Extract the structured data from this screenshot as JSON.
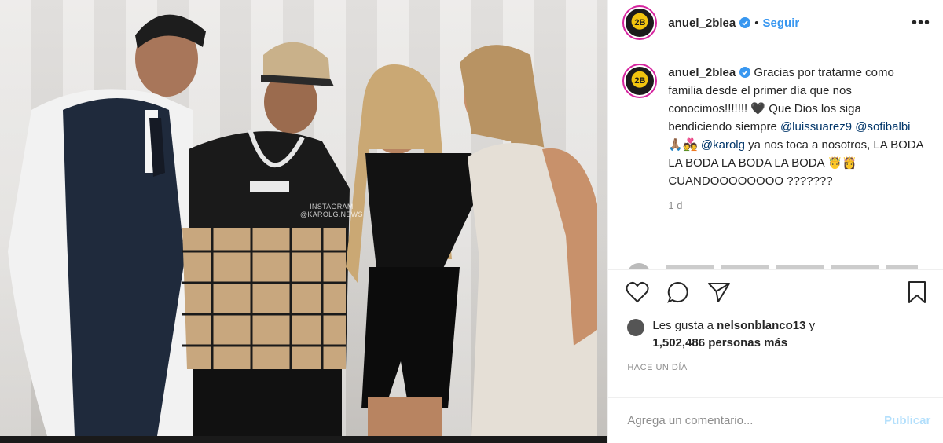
{
  "photo": {
    "watermark_line1": "INSTAGRAM",
    "watermark_line2": "@KAROLG.NEWS"
  },
  "header": {
    "username": "anuel_2blea",
    "separator": "•",
    "follow_label": "Seguir",
    "more_label": "•••"
  },
  "caption": {
    "username": "anuel_2blea",
    "text_part1": " Gracias por tratarme como familia desde el primer día que nos conocimos!!!!!!! 🖤 Que Dios los siga bendiciendo siempre ",
    "mention1": "@luissuarez9",
    "mention2": "@sofibalbi",
    "emoji1": " 🙏🏽💑 ",
    "mention3": "@karolg",
    "text_part2": " ya nos toca a nosotros, LA BODA LA BODA LA BODA LA BODA 🤴👸 CUANDOOOOOOOO ???????",
    "time": "1 d"
  },
  "likes": {
    "prefix": "Les gusta a ",
    "user": "nelsonblanco13",
    "mid": " y",
    "count": "1,502,486 personas más"
  },
  "posted": "HACE UN DÍA",
  "comment": {
    "placeholder": "Agrega un comentario...",
    "publish_label": "Publicar"
  },
  "colors": {
    "link": "#3897f0",
    "mention": "#003569",
    "muted": "#8e8e8e",
    "publish_disabled": "#b2dffc"
  }
}
